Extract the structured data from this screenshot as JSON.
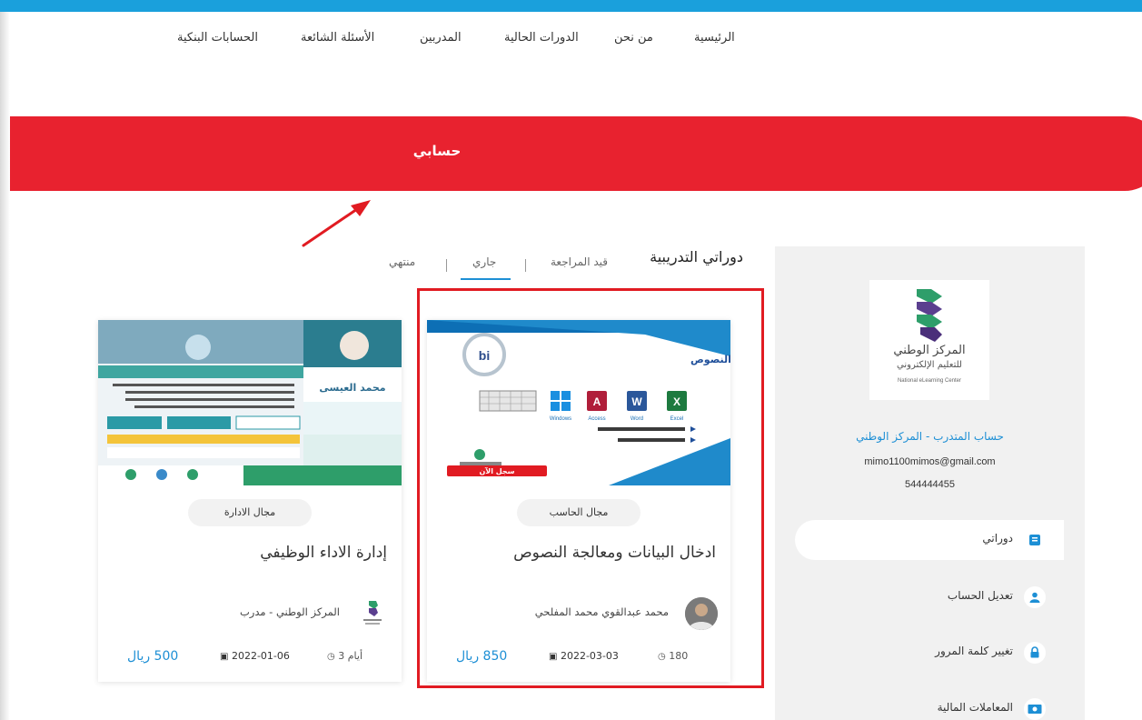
{
  "nav": {
    "items": [
      "الرئيسية",
      "من نحن",
      "الدورات الحالية",
      "المدربين",
      "الأسئلة الشائعة",
      "الحسابات البنكية"
    ]
  },
  "banner": {
    "title": "حسابي"
  },
  "sidebar": {
    "logo": {
      "name_ar": "المركز الوطني",
      "tagline_ar": "للتعليم الإلكتروني",
      "name_en": "National eLearning Center"
    },
    "account_title": "حساب المتدرب - المركز الوطني",
    "email": "mimo1100mimos@gmail.com",
    "phone": "544444455",
    "menu": [
      {
        "label": "دوراتي",
        "icon": "book-icon",
        "active": true
      },
      {
        "label": "تعديل الحساب",
        "icon": "user-icon",
        "active": false
      },
      {
        "label": "تغيير كلمة المرور",
        "icon": "lock-icon",
        "active": false
      },
      {
        "label": "المعاملات المالية",
        "icon": "money-icon",
        "active": false
      }
    ]
  },
  "courses": {
    "title": "دوراتي التدريبية",
    "tabs": [
      "قيد المراجعة",
      "جاري",
      "منتهي"
    ],
    "active_tab": "جاري",
    "cards": [
      {
        "category": "مجال الحاسب",
        "title": "ادخال البيانات ومعالجة النصوص",
        "trainer": "محمد عبدالقوي محمد المفلحي",
        "price": "850 ريال",
        "date": "2022-03-03",
        "duration": "180",
        "image": {
          "heading": "دورة إدخال البيانات ومعالجة النصوص",
          "apps": [
            "Windows",
            "Access",
            "Word",
            "Excel"
          ],
          "badge": "سجل الآن"
        }
      },
      {
        "category": "مجال الادارة",
        "title": "إدارة الاداء الوظيفي",
        "trainer": "المركز الوطني - مدرب",
        "price": "500 ريال",
        "date": "2022-01-06",
        "duration": "3 أيام",
        "image": {
          "name": "محمد العيسى"
        }
      }
    ]
  },
  "colors": {
    "accent_blue": "#1d8fd5",
    "banner_red": "#e8222f",
    "highlight_red": "#e11b22"
  }
}
